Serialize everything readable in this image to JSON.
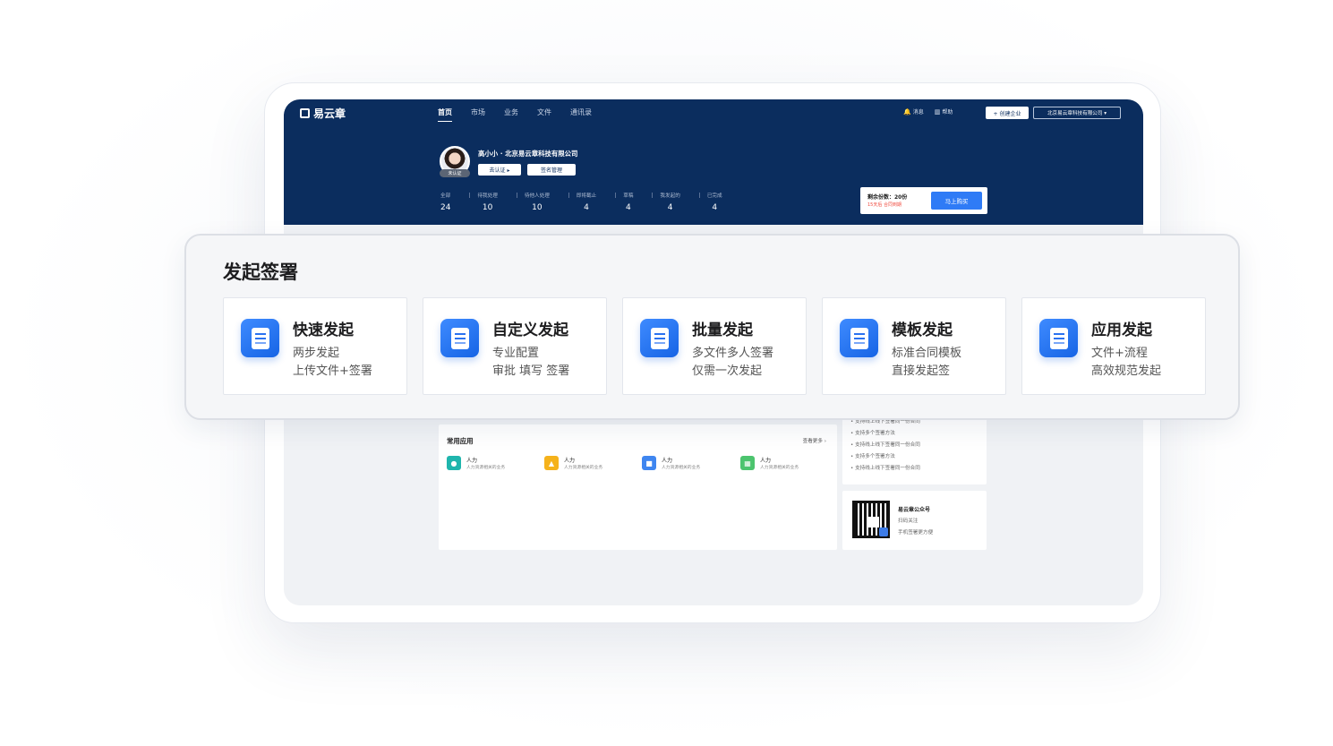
{
  "header": {
    "logo": "易云章",
    "nav": [
      "首页",
      "市场",
      "业务",
      "文件",
      "通讯录"
    ],
    "tools": {
      "message": "消息",
      "help": "帮助"
    },
    "create_button": "+ 创建企业",
    "company_select": "北京易云章科技有限公司 ▾"
  },
  "user": {
    "name": "高小小 · 北京易云章科技有限公司",
    "badge": "未认证",
    "verify_button": "去认证 ▸",
    "sign_button": "签名管理"
  },
  "stats": [
    {
      "label": "全部",
      "value": "24"
    },
    {
      "label": "待我处理",
      "value": "10"
    },
    {
      "label": "待他人处理",
      "value": "10"
    },
    {
      "label": "即将截止",
      "value": "4"
    },
    {
      "label": "草稿",
      "value": "4"
    },
    {
      "label": "我发起的",
      "value": "4"
    },
    {
      "label": "已完成",
      "value": "4"
    }
  ],
  "quota": {
    "text": "剩余份数：20份",
    "sub": "15天后 合同到期",
    "buy_button": "马上购买"
  },
  "apps": {
    "title": "常用应用",
    "more": "查看更多 ›",
    "items": [
      {
        "name": "人力",
        "desc": "人力资源相关的业务",
        "color": "#1fb5ad"
      },
      {
        "name": "人力",
        "desc": "人力资源相关的业务",
        "color": "#f5b21b"
      },
      {
        "name": "人力",
        "desc": "人力资源相关的业务",
        "color": "#3f86f0"
      },
      {
        "name": "人力",
        "desc": "人力资源相关的业务",
        "color": "#4cc46e"
      }
    ]
  },
  "help_lines": [
    "• 支持线上线下签署同一份合同",
    "• 支持多个签署方法",
    "• 支持线上线下签署同一份合同",
    "• 支持多个签署方法",
    "• 支持线上线下签署同一份合同"
  ],
  "wechat": {
    "title": "易云章公众号",
    "lines": [
      "扫码关注",
      "手机签署更方便"
    ]
  },
  "launch": {
    "title": "发起签署",
    "cards": [
      {
        "title": "快速发起",
        "line1": "两步发起",
        "line2": "上传文件+签署"
      },
      {
        "title": "自定义发起",
        "line1": "专业配置",
        "line2": "审批 填写 签署"
      },
      {
        "title": "批量发起",
        "line1": "多文件多人签署",
        "line2": "仅需一次发起"
      },
      {
        "title": "模板发起",
        "line1": "标准合同模板",
        "line2": "直接发起签"
      },
      {
        "title": "应用发起",
        "line1": "文件+流程",
        "line2": "高效规范发起"
      }
    ]
  }
}
